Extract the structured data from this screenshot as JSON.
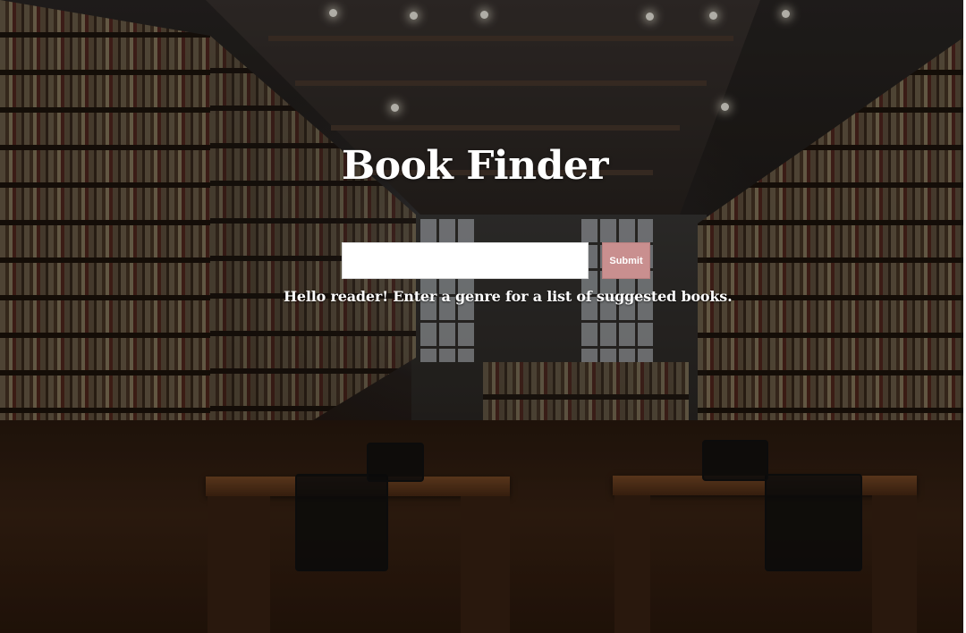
{
  "app": {
    "title": "Book Finder"
  },
  "search": {
    "value": "",
    "placeholder": "",
    "submit_label": "Submit"
  },
  "hint": {
    "text": "Hello reader! Enter a genre for a list of suggested books."
  },
  "colors": {
    "submit_background": "#c98f8f",
    "text": "#ffffff"
  }
}
